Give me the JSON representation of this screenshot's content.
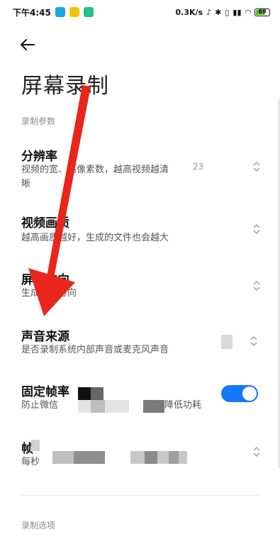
{
  "status": {
    "time": "下午4:45",
    "net_speed": "0.3K/s",
    "battery": "69"
  },
  "page": {
    "title": "屏幕录制"
  },
  "sections": {
    "params": "录制参数",
    "options": "录制选项"
  },
  "rows": [
    {
      "title": "分辨率",
      "subtitle_line1": "视频的宽、高像素数，越高视频越清",
      "subtitle_line2": "晰",
      "value": "23"
    },
    {
      "title": "视频画质",
      "subtitle": "越高画质越好，生成的文件也会越大",
      "value": ""
    },
    {
      "title": "屏幕方向",
      "subtitle": "生成视频方向",
      "value": ""
    },
    {
      "title": "声音来源",
      "subtitle": "是否录制系统内部声音或麦克风声音",
      "value": ""
    },
    {
      "title": "固定帧率",
      "subtitle": "防止微信... 降低功耗",
      "subtitle_visible_a": "防止微信",
      "subtitle_visible_b": "降低功耗",
      "toggle_on": true
    },
    {
      "title": "帧",
      "subtitle_visible": "每秒"
    }
  ],
  "colors": {
    "accent": "#1677ff",
    "annotation_arrow": "#e8261c"
  }
}
